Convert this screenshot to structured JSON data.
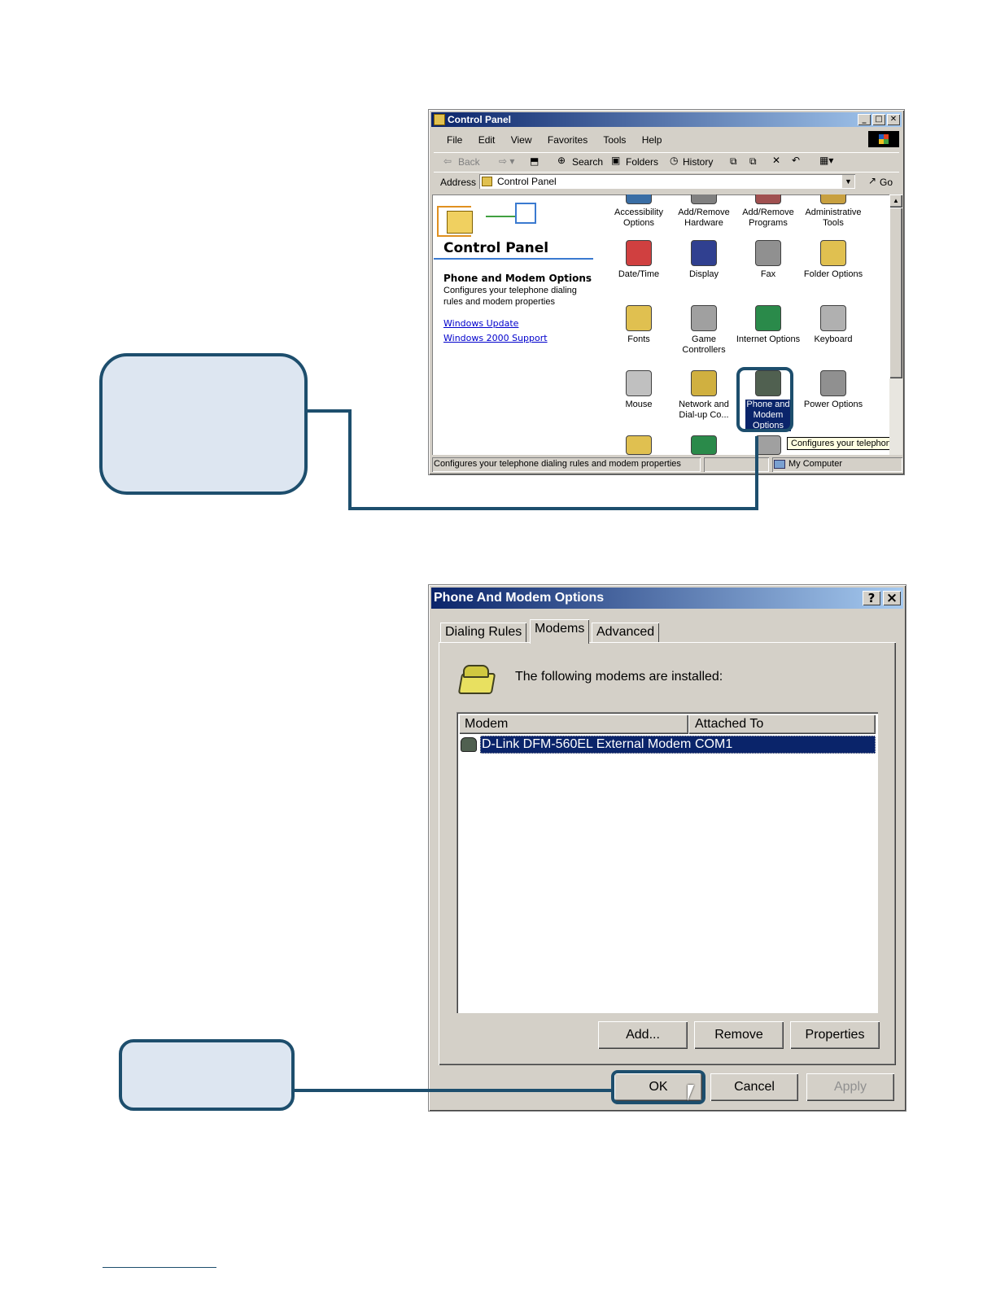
{
  "control_panel": {
    "title": "Control Panel",
    "menu": [
      "File",
      "Edit",
      "View",
      "Favorites",
      "Tools",
      "Help"
    ],
    "toolbar": {
      "back": "Back",
      "search": "Search",
      "folders": "Folders",
      "history": "History"
    },
    "address_label": "Address",
    "address_value": "Control Panel",
    "go_label": "Go",
    "sidebar": {
      "heading": "Control Panel",
      "selected_title": "Phone and Modem Options",
      "selected_desc": "Configures your telephone dialing rules and modem properties",
      "links": [
        "Windows Update",
        "Windows 2000 Support"
      ]
    },
    "icons": [
      {
        "label": "Accessibility Options",
        "color": "#3a6ea5"
      },
      {
        "label": "Add/Remove Hardware",
        "color": "#808080"
      },
      {
        "label": "Add/Remove Programs",
        "color": "#a05050"
      },
      {
        "label": "Administrative Tools",
        "color": "#c8a040"
      },
      {
        "label": "Date/Time",
        "color": "#d04040"
      },
      {
        "label": "Display",
        "color": "#304090"
      },
      {
        "label": "Fax",
        "color": "#909090"
      },
      {
        "label": "Folder Options",
        "color": "#e0c050"
      },
      {
        "label": "Fonts",
        "color": "#e0c050"
      },
      {
        "label": "Game Controllers",
        "color": "#a0a0a0"
      },
      {
        "label": "Internet Options",
        "color": "#2a8a4a"
      },
      {
        "label": "Keyboard",
        "color": "#b0b0b0"
      },
      {
        "label": "Mouse",
        "color": "#c0c0c0"
      },
      {
        "label": "Network and Dial-up Co...",
        "color": "#d0b040"
      },
      {
        "label": "Phone and Modem Options",
        "color": "#506050"
      },
      {
        "label": "Power Options",
        "color": "#909090"
      }
    ],
    "tooltip": "Configures your telephone c",
    "status_text": "Configures your telephone dialing rules and modem properties",
    "status_zone": "My Computer"
  },
  "modem_dialog": {
    "title": "Phone And Modem Options",
    "help_btn": "?",
    "close_btn": "×",
    "tabs": [
      "Dialing Rules",
      "Modems",
      "Advanced"
    ],
    "active_tab": "Modems",
    "intro": "The following modems are  installed:",
    "columns": [
      "Modem",
      "Attached To"
    ],
    "rows": [
      {
        "modem": "D-Link DFM-560EL External Modem",
        "port": "COM1"
      }
    ],
    "buttons": {
      "add": "Add...",
      "remove": "Remove",
      "properties": "Properties"
    },
    "footer": {
      "ok": "OK",
      "cancel": "Cancel",
      "apply": "Apply"
    }
  },
  "accent_color": "#1d4e6d"
}
